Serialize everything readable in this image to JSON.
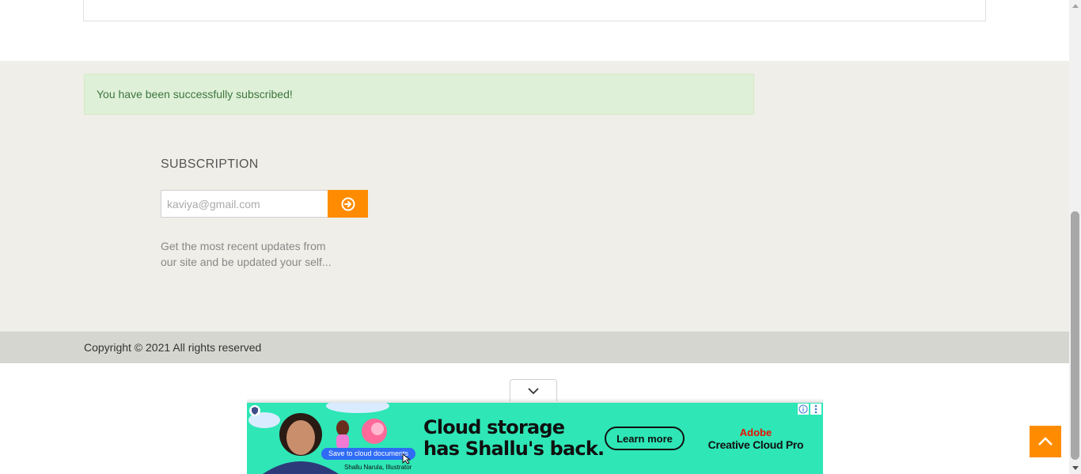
{
  "alert": {
    "message": "You have been successfully subscribed!"
  },
  "subscription": {
    "heading": "SUBSCRIPTION",
    "email_value": "kaviya@gmail.com",
    "submit_icon": "circle-arrow-right-icon",
    "description": "Get the most recent updates from our site and be updated your self..."
  },
  "footer": {
    "copyright": "Copyright © 2021 All rights reserved"
  },
  "ad": {
    "headline_line1": "Cloud storage",
    "headline_line2": "has Shallu's back.",
    "cta_label": "Learn more",
    "brand_top": "Adobe",
    "brand_bottom": "Creative Cloud Pro",
    "pill_label": "Save to cloud documents",
    "caption": "Shallu Narula, Illustrator",
    "background_color": "#2ee6b6"
  },
  "colors": {
    "accent": "#ff8c00",
    "alert_bg": "#dff0d8",
    "alert_text": "#3c763d",
    "section_bg": "#efeee8",
    "footer_bg": "#d6d6d1"
  }
}
